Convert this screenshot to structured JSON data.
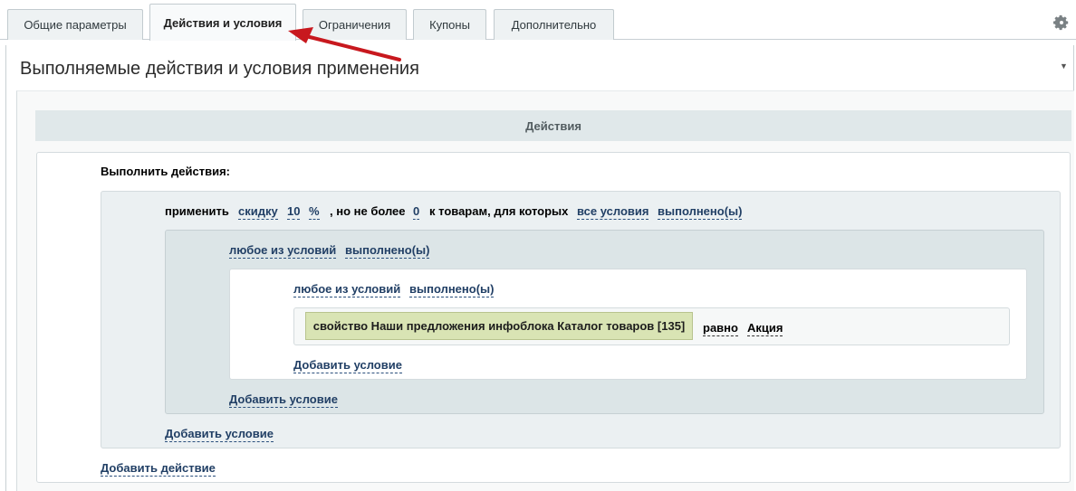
{
  "tabs": [
    {
      "label": "Общие параметры"
    },
    {
      "label": "Действия и условия"
    },
    {
      "label": "Ограничения"
    },
    {
      "label": "Купоны"
    },
    {
      "label": "Дополнительно"
    }
  ],
  "panel": {
    "title": "Выполняемые действия и условия применения",
    "section_title": "Действия"
  },
  "actions": {
    "header": "Выполнить действия:",
    "apply": "применить",
    "discount": "скидку",
    "amount": "10",
    "unit": "%",
    "not_more": ", но не более",
    "max": "0",
    "to_goods": "к товарам, для которых",
    "all_conditions": "все условия",
    "fulfilled": "выполнено(ы)",
    "group1": {
      "any": "любое из условий",
      "fulfilled": "выполнено(ы)",
      "group2": {
        "any": "любое из условий",
        "fulfilled": "выполнено(ы)",
        "property": "свойство Наши предложения инфоблока Каталог товаров [135]",
        "operator": "равно",
        "value": "Акция",
        "add_condition": "Добавить условие"
      },
      "add_condition": "Добавить условие"
    },
    "add_condition": "Добавить условие",
    "add_action": "Добавить действие"
  },
  "colors": {
    "active_arrow": "#c8181e",
    "link": "#2a4f7c",
    "property_bg": "#d9e4b4"
  },
  "icons": {
    "settings": "gear-icon",
    "collapse": "collapse-icon"
  }
}
